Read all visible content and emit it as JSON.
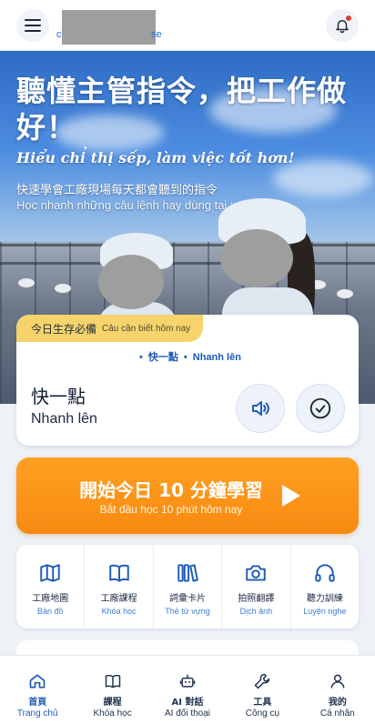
{
  "header": {
    "brand_lead": "c",
    "brand_tail": "se",
    "menu_icon": "menu-icon",
    "bell_icon": "bell-icon"
  },
  "hero": {
    "title": "聽懂主管指令，把工作做好！",
    "subtitle_vi": "Hiểu chỉ thị sếp, làm việc tốt hơn!",
    "line_zh": "快速學會工廠現場每天都會聽到的指令",
    "line_vi": "Học nhanh những câu lệnh hay dùng tại xưởng."
  },
  "phrase_card": {
    "badge_zh": "今日生存必備",
    "badge_vi": "Câu cần biết hôm nay",
    "crumb_zh": "快一點",
    "crumb_vi": "Nhanh lên",
    "phrase_zh": "快一點",
    "phrase_vi": "Nhanh lên"
  },
  "cta": {
    "title": "開始今日 10 分鐘學習",
    "subtitle": "Bắt đầu học 10 phút hôm nay"
  },
  "tools": [
    {
      "zh": "工廠地圖",
      "vi": "Bản đồ",
      "icon": "map-icon"
    },
    {
      "zh": "工廠課程",
      "vi": "Khóa học",
      "icon": "book-icon"
    },
    {
      "zh": "詞彙卡片",
      "vi": "Thẻ từ vựng",
      "icon": "cards-icon"
    },
    {
      "zh": "拍照翻譯",
      "vi": "Dịch ảnh",
      "icon": "camera-icon"
    },
    {
      "zh": "聽力訓練",
      "vi": "Luyện nghe",
      "icon": "headphones-icon"
    }
  ],
  "bottom_nav": [
    {
      "zh": "首頁",
      "vi": "Trang chủ",
      "icon": "home-icon",
      "active": true
    },
    {
      "zh": "課程",
      "vi": "Khóa học",
      "icon": "book-icon"
    },
    {
      "zh": "AI 對話",
      "vi": "AI đối thoại",
      "icon": "robot-icon"
    },
    {
      "zh": "工具",
      "vi": "Công cụ",
      "icon": "wrench-icon"
    },
    {
      "zh": "我的",
      "vi": "Cá nhân",
      "icon": "user-icon"
    }
  ],
  "colors": {
    "accent": "#1e5bb8",
    "cta": "#f78a12",
    "badge": "#f6d46b"
  }
}
